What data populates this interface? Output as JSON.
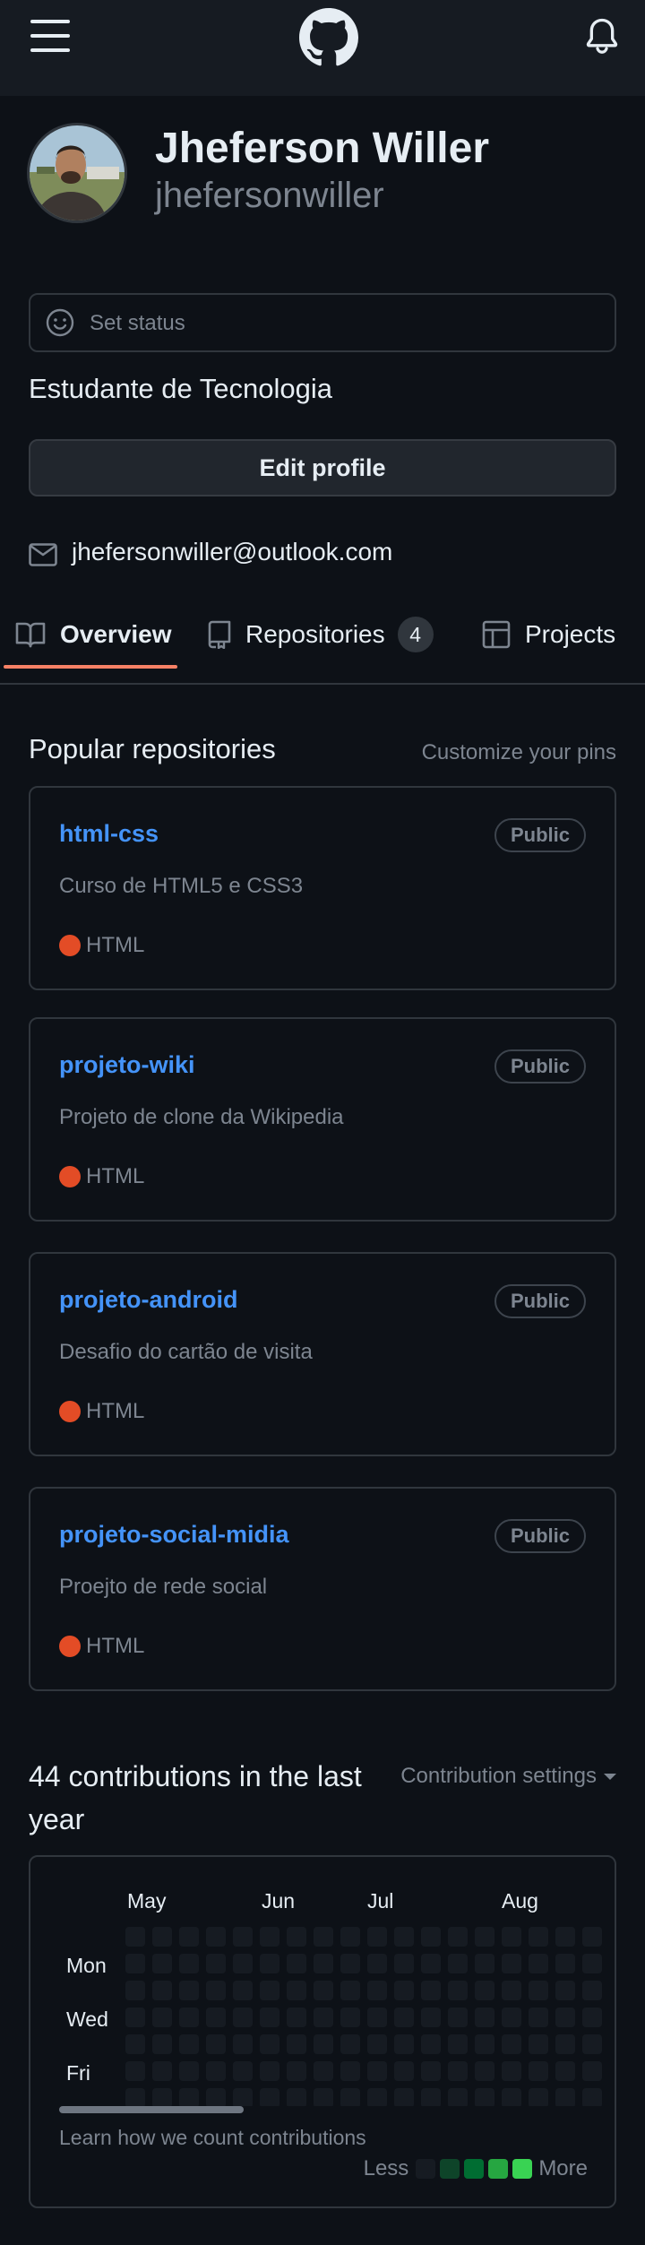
{
  "header": {
    "menu_icon": "hamburger-icon",
    "logo_icon": "github-icon",
    "notif_icon": "bell-icon"
  },
  "profile": {
    "name": "Jheferson Willer",
    "login": "jhefersonwiller",
    "status_placeholder": "Set status",
    "bio": "Estudante de Tecnologia",
    "edit_label": "Edit profile",
    "email": "jhefersonwiller@outlook.com"
  },
  "tabs": [
    {
      "label": "Overview",
      "icon": "book-icon",
      "selected": true
    },
    {
      "label": "Repositories",
      "icon": "repo-icon",
      "count": "4"
    },
    {
      "label": "Projects",
      "icon": "table-icon"
    }
  ],
  "popular": {
    "title": "Popular repositories",
    "customize": "Customize your pins",
    "repos": [
      {
        "name": "html-css",
        "visibility": "Public",
        "description": "Curso de HTML5 e CSS3",
        "language": "HTML"
      },
      {
        "name": "projeto-wiki",
        "visibility": "Public",
        "description": "Projeto de clone da Wikipedia",
        "language": "HTML"
      },
      {
        "name": "projeto-android",
        "visibility": "Public",
        "description": "Desafio do cartão de visita",
        "language": "HTML"
      },
      {
        "name": "projeto-social-midia",
        "visibility": "Public",
        "description": "Proejto de rede social",
        "language": "HTML"
      }
    ]
  },
  "contributions": {
    "title": "44 contributions in the last year",
    "settings": "Contribution settings",
    "months": [
      "May",
      "Jun",
      "Jul",
      "Aug"
    ],
    "days": [
      "Mon",
      "Wed",
      "Fri"
    ],
    "learn": "Learn how we count contributions",
    "legend_less": "Less",
    "legend_more": "More"
  },
  "colors": {
    "background": "#0d1117",
    "link": "#4493f8",
    "html_language": "#e34c26",
    "tab_underline": "#f78166",
    "legend": [
      "#161b22",
      "#0e4429",
      "#006d32",
      "#26a641",
      "#39d353"
    ]
  }
}
